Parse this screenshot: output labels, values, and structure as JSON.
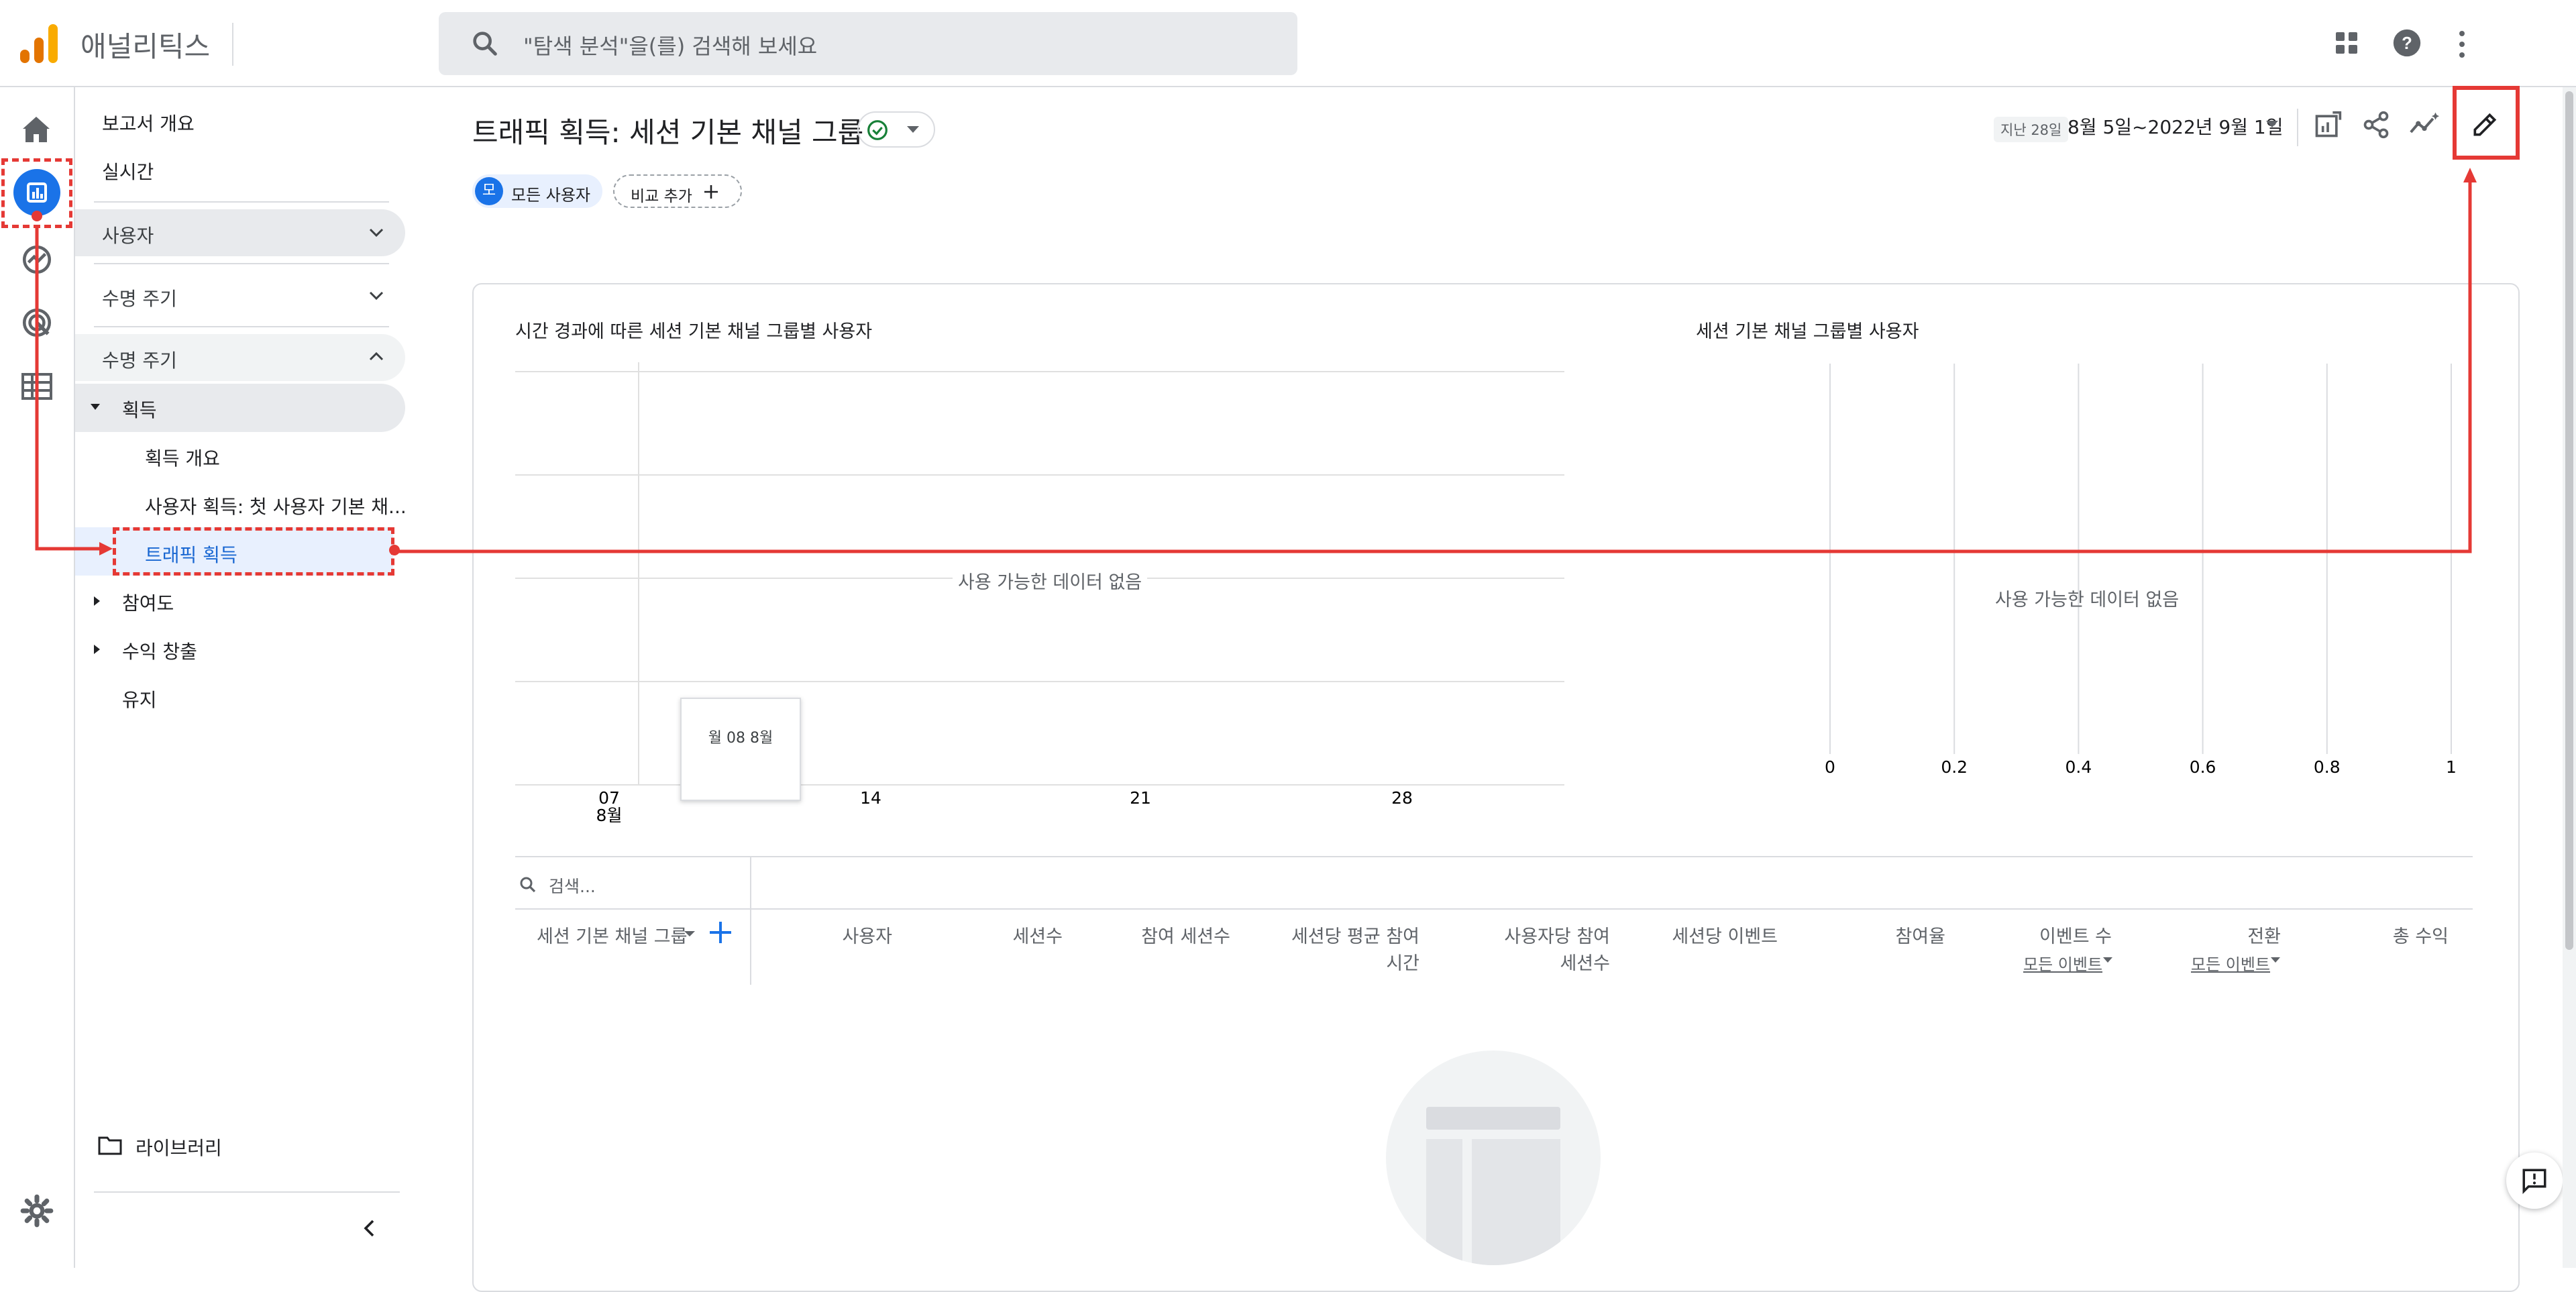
{
  "app": {
    "name": "애널리틱스"
  },
  "search": {
    "placeholder": "\"탐색 분석\"을(를) 검색해 보세요"
  },
  "nav": {
    "report_overview": "보고서 개요",
    "realtime": "실시간",
    "sections": [
      {
        "label": "사용자",
        "state": "collapsed"
      },
      {
        "label": "수명 주기",
        "state": "collapsed"
      },
      {
        "label": "수명 주기",
        "state": "expanded"
      }
    ],
    "acquisition": {
      "label": "획득",
      "children": [
        "획득 개요",
        "사용자 획득: 첫 사용자 기본 채...",
        "트래픽 획득"
      ],
      "selected": "트래픽 획득"
    },
    "engagement": "참여도",
    "monetization": "수익 창출",
    "retention": "유지",
    "library": "라이브러리"
  },
  "page": {
    "title": "트래픽 획득: 세션 기본 채널 그룹",
    "date_prefix": "지난 28일",
    "date_range": "8월 5일~2022년 9월 1일",
    "segment_chip": {
      "avatar": "모",
      "label": "모든 사용자"
    },
    "compare_chip": "비교 추가"
  },
  "charts": {
    "left_title": "시간 경과에 따른 세션 기본 채널 그룹별 사용자",
    "right_title": "세션 기본 채널 그룹별 사용자",
    "no_data": "사용 가능한 데이터 없음",
    "tooltip": "월 08 8월"
  },
  "chart_data": [
    {
      "type": "line",
      "title": "시간 경과에 따른 세션 기본 채널 그룹별 사용자",
      "x_ticks": [
        {
          "day": "07",
          "month": "8월"
        },
        {
          "day": "14",
          "month": ""
        },
        {
          "day": "21",
          "month": ""
        },
        {
          "day": "28",
          "month": ""
        }
      ],
      "series": [],
      "grid": true,
      "annotation": "사용 가능한 데이터 없음"
    },
    {
      "type": "bar",
      "title": "세션 기본 채널 그룹별 사용자",
      "x_ticks": [
        "0",
        "0.2",
        "0.4",
        "0.6",
        "0.8",
        "1"
      ],
      "xlim": [
        0,
        1
      ],
      "series": [],
      "grid": true,
      "annotation": "사용 가능한 데이터 없음"
    }
  ],
  "table": {
    "search_placeholder": "검색...",
    "dimension": "세션 기본 채널 그룹",
    "columns": [
      {
        "lines": [
          "사용자"
        ]
      },
      {
        "lines": [
          "세션수"
        ]
      },
      {
        "lines": [
          "참여 세션수"
        ]
      },
      {
        "lines": [
          "세션당 평균 참여",
          "시간"
        ]
      },
      {
        "lines": [
          "사용자당 참여",
          "세션수"
        ]
      },
      {
        "lines": [
          "세션당 이벤트"
        ]
      },
      {
        "lines": [
          "참여율"
        ]
      },
      {
        "lines": [
          "이벤트 수"
        ],
        "filter": "모든 이벤트"
      },
      {
        "lines": [
          "전환"
        ],
        "filter": "모든 이벤트"
      },
      {
        "lines": [
          "총 수익"
        ]
      }
    ]
  },
  "annotation_colors": {
    "highlight": "#e53935"
  }
}
